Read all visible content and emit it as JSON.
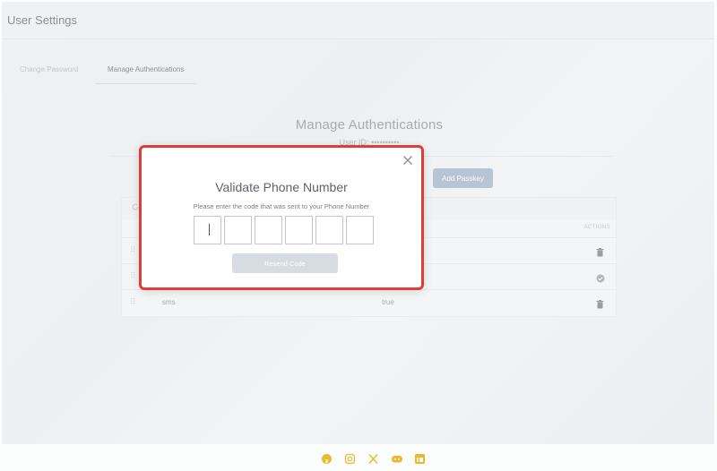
{
  "header": {
    "title": "User Settings"
  },
  "tabs": [
    {
      "label": "Change Password",
      "active": false
    },
    {
      "label": "Manage Authentications",
      "active": true
    }
  ],
  "main": {
    "title": "Manage Authentications",
    "user_id": "User ID: ••••••••••",
    "add_passkey_label": "Add Passkey",
    "table": {
      "actions_header": "ACTIONS",
      "rows": [
        {
          "name": "",
          "value": "",
          "action_icon": "trash-icon"
        },
        {
          "name": "",
          "value": "",
          "action_icon": "check-circle-icon"
        },
        {
          "name": "sms",
          "value": "true",
          "action_icon": "trash-icon"
        }
      ]
    }
  },
  "modal": {
    "title": "Validate Phone Number",
    "instruction": "Please enter the code that was sent to your Phone Number",
    "code_values": [
      "",
      "",
      "",
      "",
      "",
      ""
    ],
    "resend_label": "Resend Code",
    "highlight_color": "#e23b3b"
  },
  "footer": {
    "icons": [
      "github-icon",
      "instagram-icon",
      "x-icon",
      "discord-icon",
      "linkedin-icon"
    ],
    "icon_color": "#e9b92e"
  },
  "colors": {
    "accent_button": "#a3b3c8",
    "disabled_button": "#d7dbe2"
  }
}
